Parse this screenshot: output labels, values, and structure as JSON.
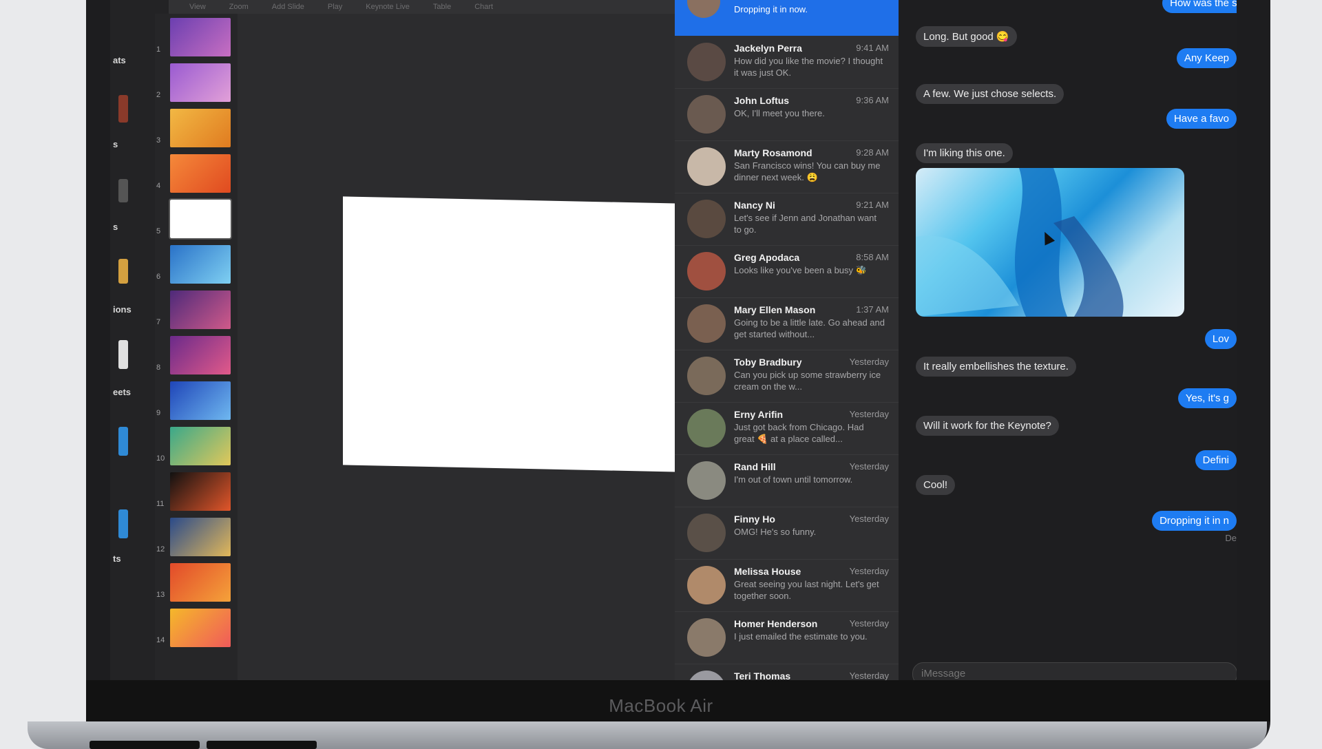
{
  "device": {
    "brand": "MacBook Air"
  },
  "keynote": {
    "toolbar": [
      "View",
      "Zoom",
      "Add Slide",
      "Play",
      "Keynote Live",
      "Table",
      "Chart"
    ],
    "left_strip": [
      "ats",
      "s",
      "s",
      "ions",
      "eets",
      "ts"
    ],
    "slides": [
      {
        "num": "1",
        "color1": "#6b3fb0",
        "color2": "#c86fc2"
      },
      {
        "num": "2",
        "color1": "#9a5bd1",
        "color2": "#e2a0d8"
      },
      {
        "num": "3",
        "color1": "#f2b844",
        "color2": "#e07b20"
      },
      {
        "num": "4",
        "color1": "#f5893a",
        "color2": "#e04a20"
      },
      {
        "num": "5",
        "color1": "#ffffff",
        "color2": "#ffffff"
      },
      {
        "num": "6",
        "color1": "#2a72c8",
        "color2": "#7fd0f2"
      },
      {
        "num": "7",
        "color1": "#4e2a7a",
        "color2": "#d05a8a"
      },
      {
        "num": "8",
        "color1": "#6a2a8a",
        "color2": "#e25a8a"
      },
      {
        "num": "9",
        "color1": "#1f45b8",
        "color2": "#6fb8f0"
      },
      {
        "num": "10",
        "color1": "#3aa88a",
        "color2": "#e2c85a"
      },
      {
        "num": "11",
        "color1": "#111111",
        "color2": "#e2562a"
      },
      {
        "num": "12",
        "color1": "#2a4a8a",
        "color2": "#e2b85a"
      },
      {
        "num": "13",
        "color1": "#e24a2a",
        "color2": "#f5a23a"
      },
      {
        "num": "14",
        "color1": "#f5b82a",
        "color2": "#f05a5a"
      }
    ]
  },
  "conversations": {
    "active_preview": "Dropping it in now.",
    "items": [
      {
        "name": "Jackelyn Perra",
        "time": "9:41 AM",
        "preview": "How did you like the movie? I thought it was just OK."
      },
      {
        "name": "John Loftus",
        "time": "9:36 AM",
        "preview": "OK, I'll meet you there."
      },
      {
        "name": "Marty Rosamond",
        "time": "9:28 AM",
        "preview": "San Francisco wins! You can buy me dinner next week. 😩"
      },
      {
        "name": "Nancy Ni",
        "time": "9:21 AM",
        "preview": "Let's see if Jenn and Jonathan want to go."
      },
      {
        "name": "Greg Apodaca",
        "time": "8:58 AM",
        "preview": "Looks like you've been a busy 🐝"
      },
      {
        "name": "Mary Ellen Mason",
        "time": "1:37 AM",
        "preview": "Going to be a little late. Go ahead and get started without..."
      },
      {
        "name": "Toby Bradbury",
        "time": "Yesterday",
        "preview": "Can you pick up some strawberry ice cream on the w..."
      },
      {
        "name": "Erny Arifin",
        "time": "Yesterday",
        "preview": "Just got back from Chicago. Had great 🍕 at a place called..."
      },
      {
        "name": "Rand Hill",
        "time": "Yesterday",
        "preview": "I'm out of town until tomorrow."
      },
      {
        "name": "Finny Ho",
        "time": "Yesterday",
        "preview": "OMG! He's so funny."
      },
      {
        "name": "Melissa House",
        "time": "Yesterday",
        "preview": "Great seeing you last night. Let's get together soon."
      },
      {
        "name": "Homer Henderson",
        "time": "Yesterday",
        "preview": "I just emailed the estimate to you."
      },
      {
        "name": "Teri Thomas",
        "time": "Yesterday",
        "preview": ""
      }
    ]
  },
  "chat": {
    "top_partial": "How was the sh",
    "incoming": [
      "Long. But good 😋",
      "A few. We just chose selects.",
      "I'm liking this one.",
      "It really embellishes the texture.",
      "Will it work for the Keynote?",
      "Cool!"
    ],
    "outgoing": [
      "Any Keep",
      "Have a favo",
      "Lov",
      "Yes, it's g",
      "Defini",
      "Dropping it in n"
    ],
    "status": "De",
    "input_placeholder": "iMessage"
  }
}
